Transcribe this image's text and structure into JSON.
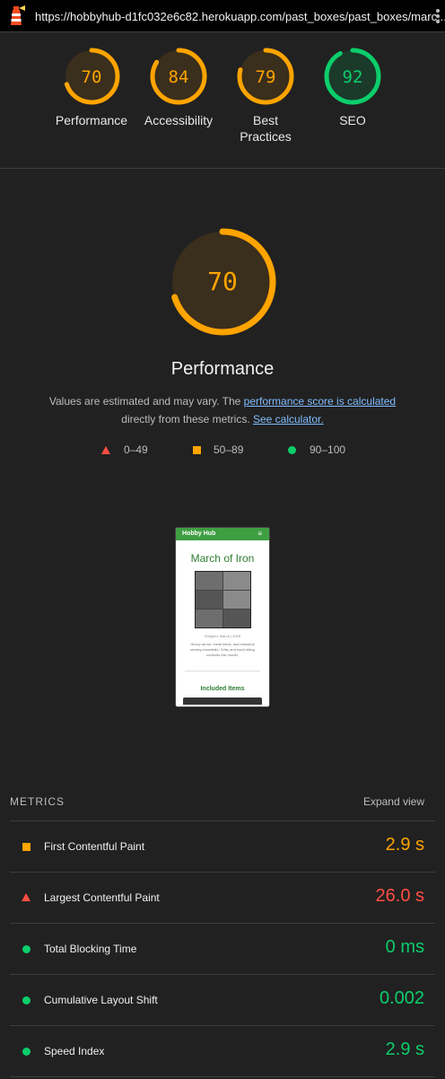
{
  "browser": {
    "url": "https://hobbyhub-d1fc032e6c82.herokuapp.com/past_boxes/past_boxes/marc..."
  },
  "colors": {
    "pass": "#0cce6b",
    "average": "#ffa400",
    "fail": "#ff4e42"
  },
  "gauges": [
    {
      "score": "70",
      "label": "Performance",
      "status": "average"
    },
    {
      "score": "84",
      "label": "Accessibility",
      "status": "average"
    },
    {
      "score": "79",
      "label": "Best Practices",
      "status": "average"
    },
    {
      "score": "92",
      "label": "SEO",
      "status": "pass"
    }
  ],
  "performance": {
    "score": "70",
    "title": "Performance",
    "desc_prefix": "Values are estimated and may vary. The ",
    "desc_link1": "performance score is calculated",
    "desc_middle": " directly from these metrics. ",
    "desc_link2": "See calculator."
  },
  "legend": {
    "fail": "0–49",
    "average": "50–89",
    "pass": "90–100"
  },
  "screenshot": {
    "brand": "Hobby Hub",
    "menu_glyph": "≡",
    "heading": "March of Iron",
    "meta": "Shipped: March | 2025",
    "paragraph": "Heavy armor, metal limbs, and industrial sewing essentials. Gritty and hard-hitting contents this month.",
    "included": "Included Items"
  },
  "metrics": {
    "heading": "METRICS",
    "expand_label": "Expand view",
    "items": [
      {
        "name": "First Contentful Paint",
        "value": "2.9 s",
        "status": "average"
      },
      {
        "name": "Largest Contentful Paint",
        "value": "26.0 s",
        "status": "fail"
      },
      {
        "name": "Total Blocking Time",
        "value": "0 ms",
        "status": "pass"
      },
      {
        "name": "Cumulative Layout Shift",
        "value": "0.002",
        "status": "pass"
      },
      {
        "name": "Speed Index",
        "value": "2.9 s",
        "status": "pass"
      }
    ]
  }
}
